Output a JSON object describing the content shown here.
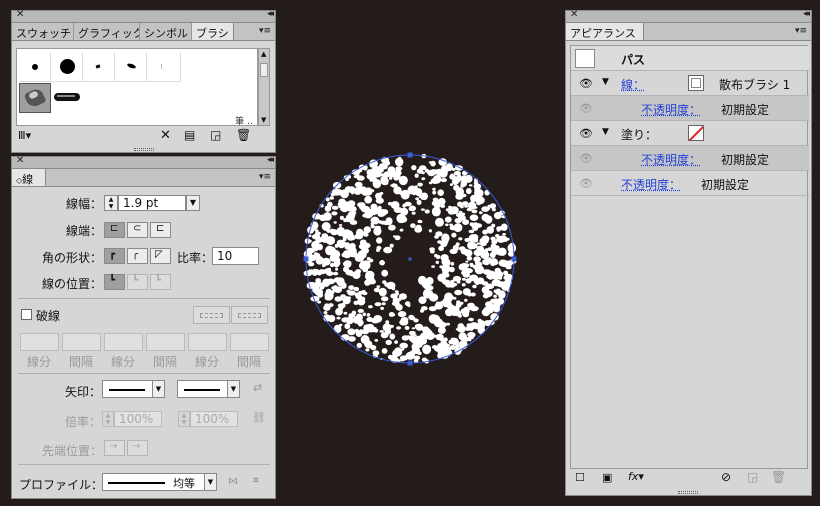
{
  "brush_panel": {
    "tabs": [
      "スウォッチ",
      "グラフィック",
      "シンボル",
      "ブラシ"
    ],
    "active_tab": "ブラシ",
    "footer_text": "筆 ‥"
  },
  "stroke_panel": {
    "tab": "線",
    "weight_label": "線幅：",
    "weight_value": "1.9 pt",
    "cap_label": "線端：",
    "corner_label": "角の形状：",
    "limit_label": "比率：",
    "limit_value": "10",
    "align_label": "線の位置：",
    "dashed_label": "破線",
    "dash_labels": [
      "線分",
      "間隔",
      "線分",
      "間隔",
      "線分",
      "間隔"
    ],
    "arrow_label": "矢印：",
    "scale_label": "倍率：",
    "scale_start": "100%",
    "scale_end": "100%",
    "tip_label": "先端位置：",
    "profile_label": "プロファイル：",
    "profile_value": "均等"
  },
  "appearance_panel": {
    "tab": "アピアランス",
    "object": "パス",
    "stroke_label": "線：",
    "stroke_value": "散布ブラシ 1",
    "stroke_opacity_label": "不透明度：",
    "stroke_opacity_value": "初期設定",
    "fill_label": "塗り：",
    "fill_opacity_label": "不透明度：",
    "fill_opacity_value": "初期設定",
    "opacity_label": "不透明度：",
    "opacity_value": "初期設定"
  },
  "colors": {
    "canvas": "#231c1a",
    "panel": "#d6d6d6",
    "selection": "#3a5ddc",
    "link": "#2342d8"
  }
}
